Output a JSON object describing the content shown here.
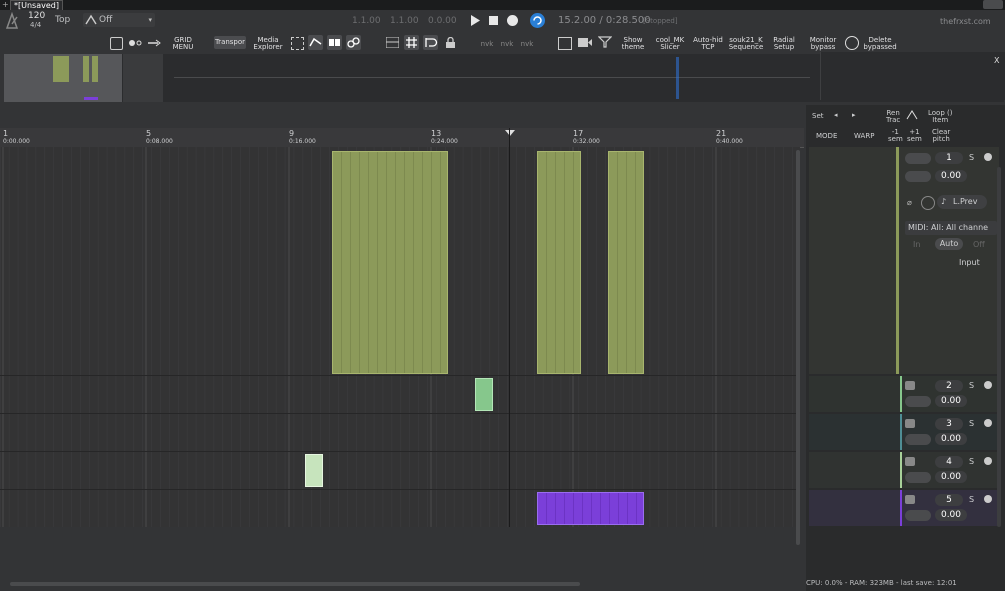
{
  "window": {
    "title": "*[Unsaved]"
  },
  "transport": {
    "tempo": "120",
    "timesig": "4/4",
    "top_label": "Top",
    "snap_value": "Off",
    "pos_a": "1.1.00",
    "pos_b": "1.1.00",
    "pos_c": "0.0.00",
    "time_display": "15.2.00 / 0:28.500",
    "state": "[Stopped]",
    "brand": "thefrxst.com"
  },
  "toolbar": {
    "grid_menu": "GRID\nMENU",
    "transport": "Transpor",
    "media_explorer": "Media\nExplorer",
    "show_theme": "Show\ntheme",
    "cool_mk_slicer": "cool_MK\nSlicer",
    "auto_hid_tcp": "Auto-hid\nTCP",
    "souk21_sequence": "souk21_K\nSequence",
    "radial_setup": "Radial\nSetup",
    "monitor_bypass": "Monitor\nbypass",
    "delete_bypassed": "Delete\nbypassed",
    "nvk1": "nvk",
    "nvk2": "nvk",
    "nvk3": "nvk"
  },
  "ruler": {
    "marks": [
      {
        "bar": "1",
        "time": "0:00.000"
      },
      {
        "bar": "5",
        "time": "0:08.000"
      },
      {
        "bar": "9",
        "time": "0:16.000"
      },
      {
        "bar": "13",
        "time": "0:24.000"
      },
      {
        "bar": "17",
        "time": "0:32.000"
      },
      {
        "bar": "21",
        "time": "0:40.000"
      }
    ]
  },
  "right_panel": {
    "set": "Set",
    "ren_track": "Ren\nTrac",
    "loop_item": "Loop ()\nItem",
    "mode": "MODE",
    "warp": "WARP",
    "minus_sem": "-1\nsem",
    "plus_sem": "+1\nsem",
    "clear_pitch": "Clear\npitch",
    "close": "X"
  },
  "tracks": [
    {
      "num": "1",
      "vol": "0.00",
      "solo": "S",
      "input_name": "L.Prev",
      "midi": "MIDI: All: All channe",
      "in": "In",
      "auto": "Auto",
      "off": "Off",
      "input_label": "Input",
      "color": "#8c9a5a"
    },
    {
      "num": "2",
      "vol": "0.00",
      "solo": "S",
      "color": "#86c78c"
    },
    {
      "num": "3",
      "vol": "0.00",
      "solo": "S",
      "color": "#4f8e95"
    },
    {
      "num": "4",
      "vol": "0.00",
      "solo": "S",
      "color": "#a8d19a"
    },
    {
      "num": "5",
      "vol": "0.00",
      "solo": "S",
      "color": "#7b3fd9"
    }
  ],
  "status": {
    "text": "CPU: 0.0% - RAM: 323MB - last save: 12:01"
  }
}
